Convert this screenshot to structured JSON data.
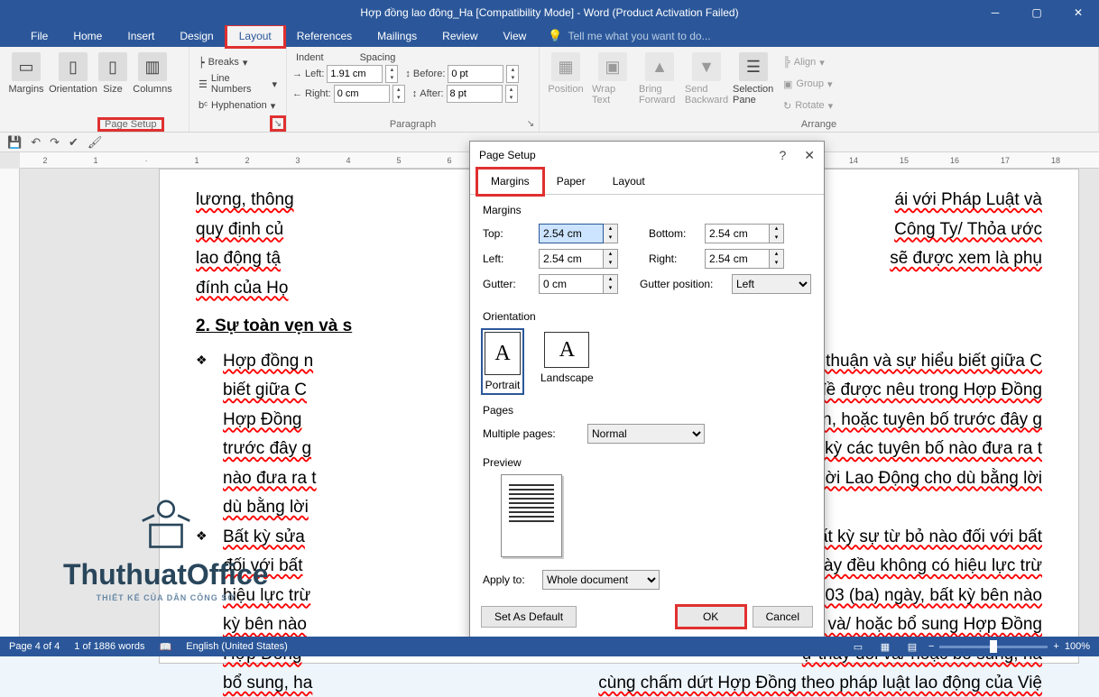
{
  "title": "Hợp đồng lao đông_Ha [Compatibility Mode] - Word (Product Activation Failed)",
  "tabs": {
    "file": "File",
    "home": "Home",
    "insert": "Insert",
    "design": "Design",
    "layout": "Layout",
    "references": "References",
    "mailings": "Mailings",
    "review": "Review",
    "view": "View",
    "tellme": "Tell me what you want to do..."
  },
  "ribbon": {
    "pagesetup": {
      "label": "Page Setup",
      "margins": "Margins",
      "orientation": "Orientation",
      "size": "Size",
      "columns": "Columns",
      "breaks": "Breaks",
      "linenum": "Line Numbers",
      "hyphen": "Hyphenation"
    },
    "paragraph": {
      "label": "Paragraph",
      "indent": "Indent",
      "spacing": "Spacing",
      "left": "Left:",
      "right": "Right:",
      "before": "Before:",
      "after": "After:",
      "leftv": "1.91 cm",
      "rightv": "0 cm",
      "beforev": "0 pt",
      "afterv": "8 pt"
    },
    "arrange": {
      "label": "Arrange",
      "position": "Position",
      "wrap": "Wrap Text",
      "forward": "Bring Forward",
      "backward": "Send Backward",
      "selpane": "Selection Pane",
      "align": "Align",
      "group": "Group",
      "rotate": "Rotate"
    }
  },
  "doc": {
    "p1": "lương, thông",
    "p1b": "ái với Pháp Luật và",
    "p2": "quy định củ",
    "p2b": "Công Ty/ Thỏa ước",
    "p3": "lao động tậ",
    "p3b": "sẽ được xem là phụ",
    "p4": "đính của Họ",
    "h1": "2. Sự toàn vẹn và s",
    "b1a": "Hợp đồng n",
    "b1b": "òa thuận và sự hiểu biết giữa C",
    "b1c": "đề được nêu trong Hợp Đồng",
    "b1d": "luận, hoặc tuyên bố trước đây g",
    "b1e": "bất kỳ các tuyên bố nào đưa ra t",
    "b1f": "gười Lao Động cho dù bằng lời",
    "b2a": "Bất kỳ sửa",
    "b2b": "bất kỳ sự từ bỏ nào đối với bất",
    "b2c": "ng này đều không có hiệu lực trừ",
    "b2d": "ớc 03 (ba) ngày, bất kỳ bên nào",
    "b2e": "ội và/ hoặc bổ sung Hợp Đồng",
    "b2f": "ự thay đổi và/ hoặc bổ sung, ha",
    "b2g": "cùng chấm dứt Hợp Đồng theo pháp luật lao động của Việ"
  },
  "dialog": {
    "title": "Page Setup",
    "tabs": {
      "margins": "Margins",
      "paper": "Paper",
      "layout": "Layout"
    },
    "margins": {
      "label": "Margins",
      "top": "Top:",
      "bottom": "Bottom:",
      "left": "Left:",
      "right": "Right:",
      "gutter": "Gutter:",
      "gutterpos": "Gutter position:",
      "topv": "2.54 cm",
      "bottomv": "2.54 cm",
      "leftv": "2.54 cm",
      "rightv": "2.54 cm",
      "gutterv": "0 cm",
      "gutterposv": "Left"
    },
    "orientation": {
      "label": "Orientation",
      "portrait": "Portrait",
      "landscape": "Landscape"
    },
    "pages": {
      "label": "Pages",
      "multi": "Multiple pages:",
      "multiv": "Normal"
    },
    "preview": {
      "label": "Preview"
    },
    "apply": {
      "label": "Apply to:",
      "value": "Whole document"
    },
    "buttons": {
      "default": "Set As Default",
      "ok": "OK",
      "cancel": "Cancel"
    }
  },
  "status": {
    "page": "Page 4 of 4",
    "words": "1 of 1886 words",
    "lang": "English (United States)",
    "zoom": "100%"
  },
  "watermark": {
    "name": "ThuthuatOffice",
    "sub": "THIẾT KẾ CỦA DÂN CÔNG SỞ"
  }
}
